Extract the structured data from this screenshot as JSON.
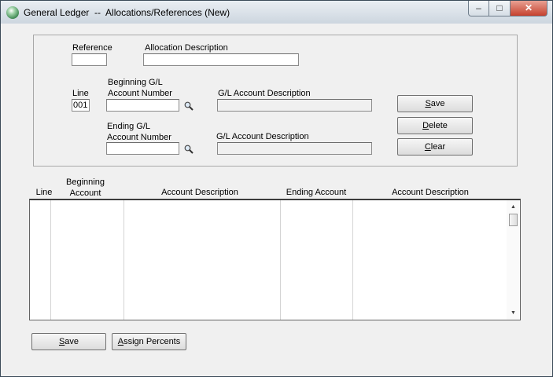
{
  "window": {
    "title": "General Ledger  --  Allocations/References (New)",
    "controls": {
      "minimize": "–",
      "maximize": "□",
      "close": "✕"
    }
  },
  "form": {
    "reference": {
      "label": "Reference",
      "value": ""
    },
    "allocation_description": {
      "label": "Allocation Description",
      "value": ""
    },
    "line": {
      "label": "Line",
      "value": "001"
    },
    "beginning_gl": {
      "label_line1": "Beginning G/L",
      "label_line2": "Account Number",
      "value": ""
    },
    "beginning_gl_description": {
      "label": "G/L Account Description",
      "value": ""
    },
    "ending_gl": {
      "label_line1": "Ending  G/L",
      "label_line2": "Account Number",
      "value": ""
    },
    "ending_gl_description": {
      "label": "G/L Account Description",
      "value": ""
    }
  },
  "buttons": {
    "save": {
      "hotkey": "S",
      "rest": "ave"
    },
    "delete": {
      "hotkey": "D",
      "rest": "elete"
    },
    "clear": {
      "hotkey": "C",
      "rest": "lear"
    },
    "bottom_save": {
      "hotkey": "S",
      "rest": "ave"
    },
    "assign_percents": {
      "hotkey": "A",
      "rest": "ssign Percents"
    }
  },
  "grid": {
    "columns": {
      "line": "Line",
      "beginning_account_1": "Beginning",
      "beginning_account_2": "Account",
      "account_description": "Account Description",
      "ending_account": "Ending Account",
      "account_description_2": "Account Description"
    },
    "rows": []
  },
  "icons": {
    "lookup": "magnifier-icon",
    "scroll_up": "up-arrow-icon",
    "scroll_down": "down-arrow-icon"
  }
}
